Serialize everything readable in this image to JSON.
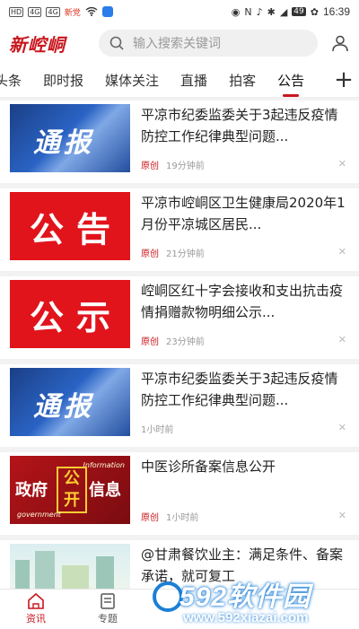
{
  "status_bar": {
    "left_chips": [
      "HD",
      "4G",
      "4G"
    ],
    "app_badge_text": "新党",
    "battery": "49",
    "time": "16:39"
  },
  "header": {
    "logo": "新崆峒",
    "search_placeholder": "输入搜索关键词"
  },
  "tabs": [
    "头条",
    "即时报",
    "媒体关注",
    "直播",
    "拍客",
    "公告"
  ],
  "active_tab": "公告",
  "add_tab": "+",
  "feed": [
    {
      "thumb": "通报",
      "title": "平凉市纪委监委关于3起违反疫情防控工作纪律典型问题...",
      "source": "原创",
      "time": "19分钟前"
    },
    {
      "thumb": "公告",
      "title": "平凉市崆峒区卫生健康局2020年1月份平凉城区居民...",
      "source": "原创",
      "time": "21分钟前"
    },
    {
      "thumb": "公示",
      "title": "崆峒区红十字会接收和支出抗击疫情捐赠款物明细公示...",
      "source": "原创",
      "time": "23分钟前"
    },
    {
      "thumb": "通报",
      "title": "平凉市纪委监委关于3起违反疫情防控工作纪律典型问题...",
      "source": "",
      "time": "1小时前"
    },
    {
      "thumb_parts": {
        "left": "政府",
        "mid": "公开",
        "right": "信息",
        "small_top": "Information",
        "small_bottom": "government"
      },
      "title": "中医诊所备案信息公开",
      "source": "原创",
      "time": "1小时前"
    },
    {
      "title": "@甘肃餐饮业主：满足条件、备案承诺，就可复工",
      "source": "",
      "time": ""
    }
  ],
  "close_glyph": "✕",
  "bottom_nav": [
    {
      "label": "资讯"
    },
    {
      "label": "专题"
    }
  ],
  "watermark": {
    "brand": "592软件园",
    "url": "www.592xiazai.com"
  },
  "colors": {
    "accent": "#c8161d"
  }
}
